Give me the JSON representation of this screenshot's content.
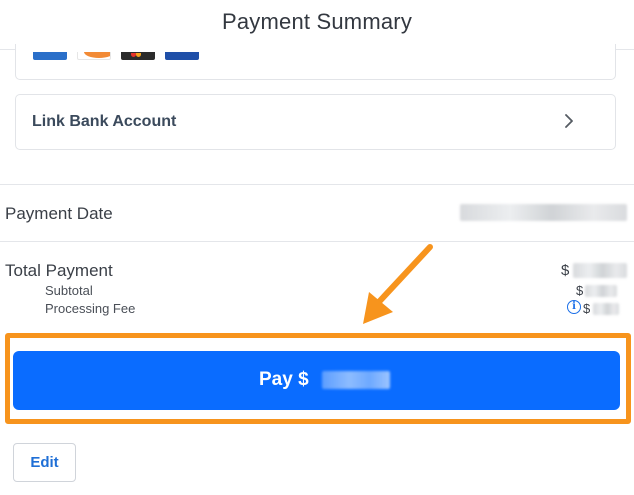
{
  "header": {
    "title": "Payment Summary"
  },
  "payment_methods": {
    "cards": [
      "amex-icon",
      "discover-icon",
      "mastercard-icon",
      "visa-icon"
    ],
    "link_bank_label": "Link Bank Account"
  },
  "summary": {
    "payment_date_label": "Payment Date",
    "total_payment_label": "Total Payment",
    "subtotal_label": "Subtotal",
    "processing_fee_label": "Processing Fee",
    "currency_symbol": "$",
    "info_glyph": "i"
  },
  "actions": {
    "pay_label": "Pay $",
    "edit_label": "Edit"
  },
  "colors": {
    "primary": "#0a6cff",
    "highlight": "#f7941d",
    "link": "#1f6fd6"
  }
}
